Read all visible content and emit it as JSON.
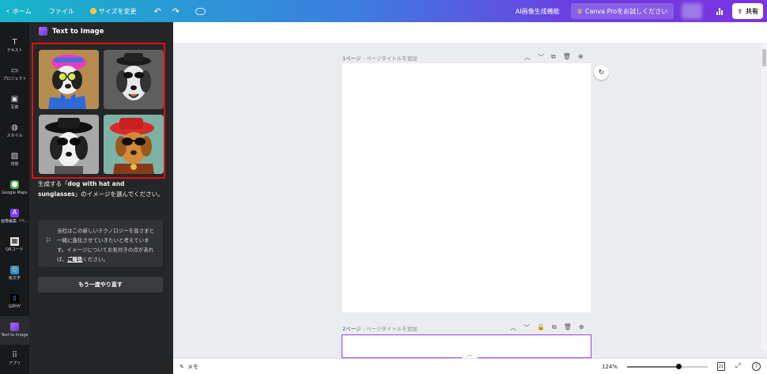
{
  "topbar": {
    "back_icon": "chevron-left-icon",
    "home": "ホーム",
    "file": "ファイル",
    "resize": "サイズを変更",
    "ai_image": "AI画像生成機能",
    "canva_pro": "Canva Proをお試しください",
    "share": "共有"
  },
  "rail": {
    "items": [
      {
        "label": "テキスト",
        "icon": "text-icon"
      },
      {
        "label": "プロジェクト",
        "icon": "folder-icon"
      },
      {
        "label": "写真",
        "icon": "image-icon"
      },
      {
        "label": "スタイル",
        "icon": "palette-icon"
      },
      {
        "label": "背景",
        "icon": "background-icon"
      },
      {
        "label": "Google Maps",
        "icon": "map-pin-icon"
      },
      {
        "label": "画像編集（ベ...",
        "icon": "image-editor-icon"
      },
      {
        "label": "QRコード",
        "icon": "qr-icon"
      },
      {
        "label": "絵文字",
        "icon": "emoji-icon"
      },
      {
        "label": "GIPHY",
        "icon": "giphy-icon"
      },
      {
        "label": "Text to Image",
        "icon": "text-to-image-icon"
      },
      {
        "label": "アプリ",
        "icon": "apps-grid-icon"
      }
    ]
  },
  "panel": {
    "title": "Text to Image",
    "desc_prefix": "生成する「",
    "desc_prompt": "dog with hat and sunglasses",
    "desc_suffix": "」のイメージを選んでください。",
    "notice_text": "当社はこの新しいテクノロジーを皆さまと一緒に進化させていきたいと考えています。イメージについてお気付きの点があれば、",
    "notice_link": "ご報告",
    "notice_end": "ください。",
    "retry": "もう一度やり直す",
    "images": [
      "dog-pink-cap-bowtie",
      "dog-bw-hat",
      "dog-bw-hat-glasses",
      "dog-red-hat-collar"
    ]
  },
  "canvas": {
    "page1_label": "1ページ",
    "page1_sub": " - ページタイトルを追加",
    "page2_label": "2ページ",
    "page2_sub": " - ページタイトルを追加"
  },
  "bottombar": {
    "memo": "メモ",
    "zoom": "124%",
    "zoom_fraction": 0.62,
    "pages_count": "21"
  }
}
